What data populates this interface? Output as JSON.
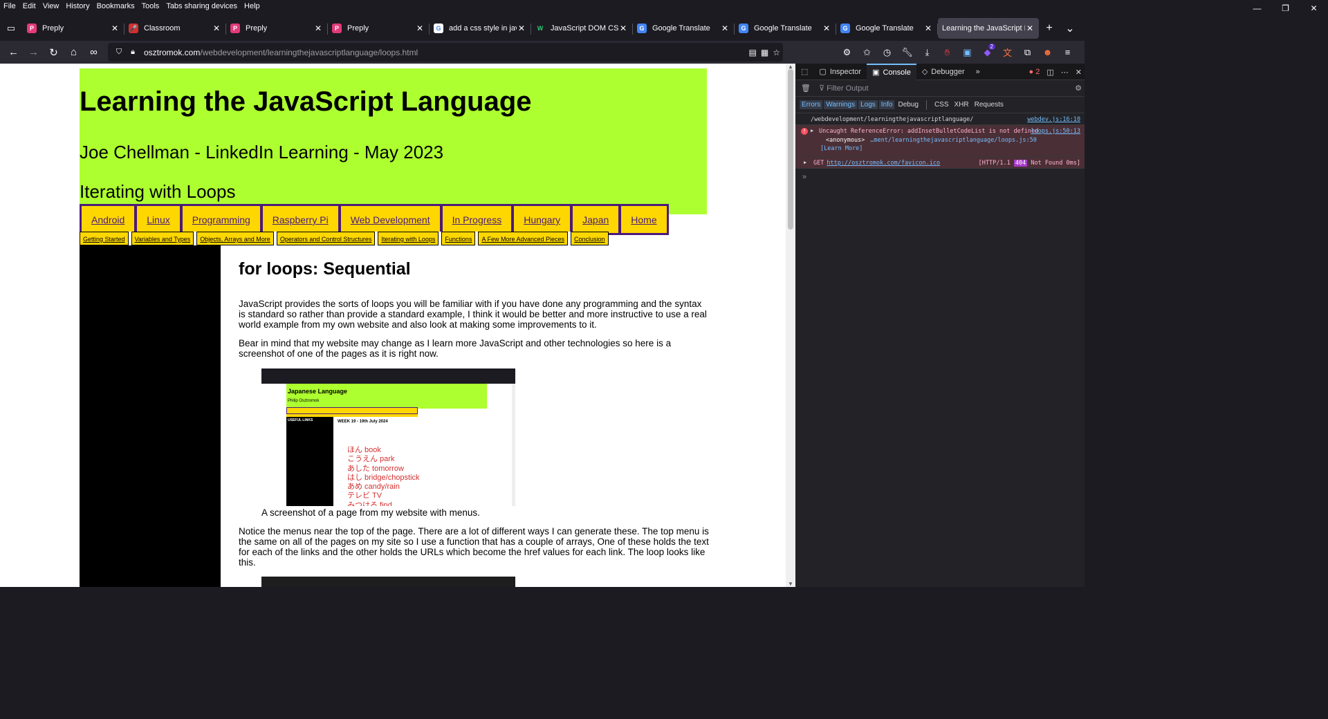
{
  "menubar": [
    "File",
    "Edit",
    "View",
    "History",
    "Bookmarks",
    "Tools",
    "Tabs sharing devices",
    "Help"
  ],
  "window_controls": {
    "minimize": "—",
    "restore": "❐",
    "close": "✕"
  },
  "tabs": [
    {
      "title": "Preply",
      "favicon_color": "#e33a7a",
      "favicon_letter": "P"
    },
    {
      "title": "Classroom",
      "favicon_color": "#d32f2f",
      "favicon_letter": "🎤"
    },
    {
      "title": "Preply",
      "favicon_color": "#e33a7a",
      "favicon_letter": "P"
    },
    {
      "title": "Preply",
      "favicon_color": "#e33a7a",
      "favicon_letter": "P"
    },
    {
      "title": "add a css style in javas",
      "favicon_color": "#ffffff",
      "favicon_letter": "G"
    },
    {
      "title": "JavaScript DOM CSS",
      "favicon_color": "#1c1b22",
      "favicon_letter": "W"
    },
    {
      "title": "Google Translate",
      "favicon_color": "#4285f4",
      "favicon_letter": "G"
    },
    {
      "title": "Google Translate",
      "favicon_color": "#4285f4",
      "favicon_letter": "G"
    },
    {
      "title": "Google Translate",
      "favicon_color": "#4285f4",
      "favicon_letter": "G"
    },
    {
      "title": "Learning the JavaScript Lan",
      "favicon_color": "",
      "favicon_letter": "",
      "active": true
    }
  ],
  "url": {
    "host": "osztromok.com",
    "path": "/webdevelopment/learningthejavascriptlanguage/loops.html"
  },
  "toolbar_badges": {
    "extension_count": "2"
  },
  "page": {
    "title": "Learning the JavaScript Language",
    "subtitle": "Joe Chellman - LinkedIn Learning - May 2023",
    "section": "Iterating with Loops",
    "top_menu": [
      "Android",
      "Linux",
      "Programming",
      "Raspberry Pi",
      "Web Development",
      "In Progress",
      "Hungary",
      "Japan",
      "Home"
    ],
    "sub_menu": [
      "Getting Started",
      "Variables and Types",
      "Objects, Arrays and More",
      "Operators and Control Structures",
      "Iterating with Loops",
      "Functions",
      "A Few More Advanced Pieces",
      "Conclusion"
    ],
    "heading": "for loops: Sequential",
    "para1": "JavaScript provides the sorts of loops you will be familiar with if you have done any programming and the syntax is standard so rather than provide a standard example, I think it would be better and more instructive to use a real world example from my own website and also look at making some improvements to it.",
    "para2": "Bear in mind that my website may change as I learn more JavaScript and other technologies so here is a screenshot of one of the pages as it is right now.",
    "screenshot": {
      "title": "Japanese Language",
      "author": "Philip Osztromok",
      "side_title": "USEFUL LINKS",
      "week": "WEEK 19 - 19th July 2024",
      "vocab": [
        "ほん book",
        "こうえん park",
        "あした tomorrow",
        "はし bridge/chopstick",
        "あめ candy/rain",
        "テレビ TV",
        "みつける find"
      ]
    },
    "caption": "A screenshot of a page from my website with menus.",
    "para3": "Notice the menus near the top of the page. There are a lot of different ways I can generate these. The top menu is the same on all of the pages on my site so I use a function that has a couple of arrays, One of these holds the text for each of the links and the other holds the URLs which become the href values for each link. The loop looks like this."
  },
  "devtools": {
    "tabs": [
      "Inspector",
      "Console",
      "Debugger"
    ],
    "error_count": "2",
    "filter_placeholder": "Filter Output",
    "levels": [
      "Errors",
      "Warnings",
      "Logs",
      "Info",
      "Debug"
    ],
    "types": [
      "CSS",
      "XHR",
      "Requests"
    ],
    "messages": {
      "log_text": "/webdevelopment/learningthejavascriptlanguage/",
      "log_src": "webdev.js:16:10",
      "error_text": "Uncaught ReferenceError: addInsetBulletCodeList is not defined",
      "error_src": "loops.js:50:13",
      "error_frame": "<anonymous>",
      "error_frame_loc": "…ment/learningthejavascriptlanguage/loops.js:50",
      "learn_more": "[Learn More]",
      "net_method": "GET",
      "net_url": "http://osztromok.com/favicon.ico",
      "net_status_pre": "[HTTP/1.1",
      "net_code": "404",
      "net_status_post": "Not Found 0ms]"
    }
  }
}
